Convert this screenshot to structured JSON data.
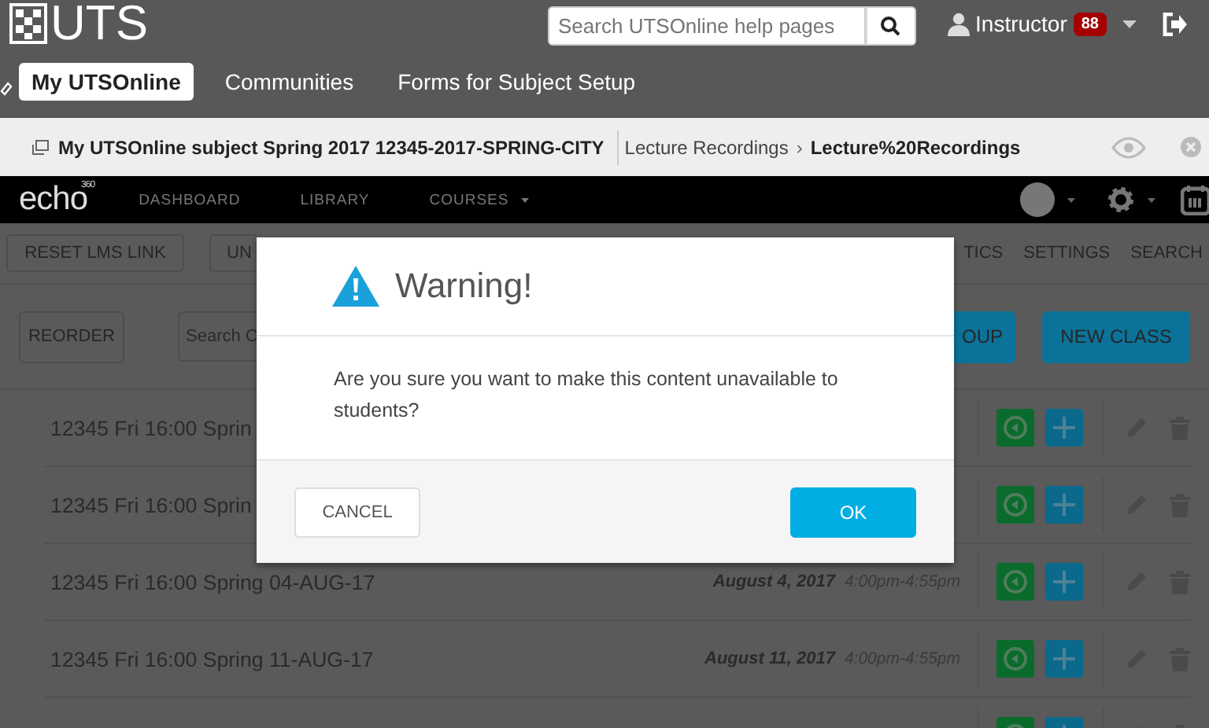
{
  "header": {
    "logo": "UTS",
    "search": {
      "placeholder": "Search UTSOnline help pages"
    },
    "user": {
      "name": "Instructor",
      "badge": "88"
    }
  },
  "tabs": [
    {
      "label": "My UTSOnline",
      "selected": true
    },
    {
      "label": "Communities",
      "selected": false
    },
    {
      "label": "Forms for Subject Setup",
      "selected": false
    }
  ],
  "breadcrumb": {
    "course": "My UTSOnline subject Spring 2017 12345-2017-SPRING-CITY",
    "separator": "›",
    "items": [
      {
        "label": "Lecture Recordings",
        "current": false
      },
      {
        "label": "Lecture%20Recordings",
        "current": true
      }
    ]
  },
  "echo_nav": {
    "logo": "echo",
    "logo_sup": "360",
    "items": [
      "DASHBOARD",
      "LIBRARY",
      "COURSES"
    ]
  },
  "toolbar": {
    "left": [
      "RESET LMS LINK",
      "UN"
    ],
    "right": [
      "TICS",
      "SETTINGS",
      "SEARCH"
    ]
  },
  "actions": {
    "reorder": "REORDER",
    "search_placeholder": "Search C",
    "buttons": [
      "OUP",
      "NEW CLASS"
    ]
  },
  "classes": [
    {
      "kind": "class",
      "title": "12345 Fri 16:00 Sprin"
    },
    {
      "kind": "class",
      "title": "12345 Fri 16:00 Sprin"
    },
    {
      "kind": "class",
      "title": "12345 Fri 16:00 Spring 04-AUG-17",
      "date": "August 4, 2017",
      "time": "4:00pm-4:55pm"
    },
    {
      "kind": "class",
      "title": "12345 Fri 16:00 Spring 11-AUG-17",
      "date": "August 11, 2017",
      "time": "4:00pm-4:55pm"
    },
    {
      "kind": "class"
    }
  ],
  "dialog": {
    "title": "Warning!",
    "message": "Are you sure you want to make this content unavailable to students?",
    "buttons": [
      {
        "label": "CANCEL",
        "kind": "secondary"
      },
      {
        "label": "OK",
        "kind": "primary"
      }
    ]
  }
}
